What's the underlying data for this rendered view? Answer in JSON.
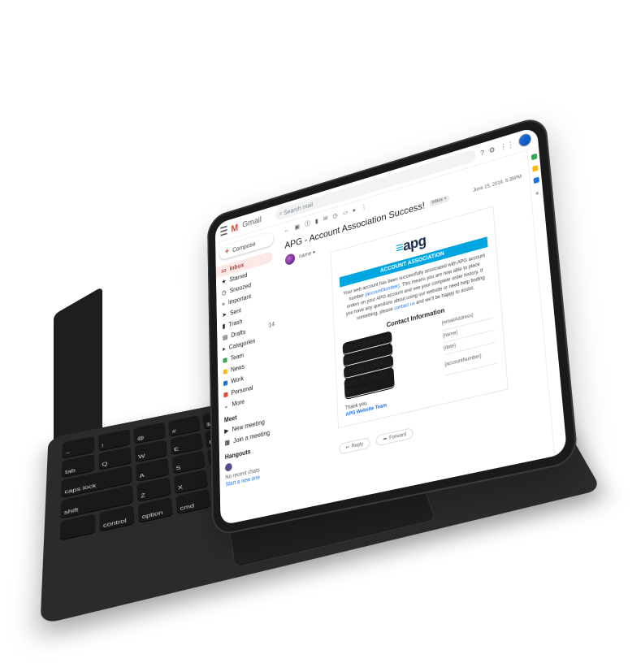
{
  "gmail": {
    "brand_text": "Gmail",
    "search_placeholder": "Search mail",
    "compose_label": "Compose",
    "nav": [
      {
        "label": "Inbox",
        "active": true
      },
      {
        "label": "Starred"
      },
      {
        "label": "Snoozed"
      },
      {
        "label": "Important"
      },
      {
        "label": "Sent"
      },
      {
        "label": "Trash"
      },
      {
        "label": "Drafts",
        "count": "14"
      },
      {
        "label": "Categories"
      },
      {
        "label": "Team"
      },
      {
        "label": "News"
      },
      {
        "label": "Work"
      },
      {
        "label": "Personal"
      },
      {
        "label": "More"
      }
    ],
    "meet": {
      "title": "Meet",
      "new_meeting": "New meeting",
      "join_meeting": "Join a meeting"
    },
    "hangouts": {
      "title": "Hangouts",
      "no_chats": "No recent chats",
      "start_new": "Start a new one"
    },
    "email": {
      "subject": "APG - Account Association Success!",
      "label": "Inbox ×",
      "date": "June 15, 2019, 5:35PM",
      "sender": "name ▾",
      "logo_prefix": "≡",
      "logo_text": "apg",
      "banner": "ACCOUNT ASSOCIATION",
      "body_part1": "Your web account has been successfully associated with APG account number ",
      "body_account": "{accountNumber}",
      "body_part2": ". This means you are now able to place orders on your APG account and see your complete order history. If you have any questions about using our website or need help finding something, please ",
      "body_contact": "contact us",
      "body_part3": " and we'll be happy to assist.",
      "contact_title": "Contact Information",
      "contact_rows": [
        {
          "key": "Email Address",
          "value": "{emailAddress}"
        },
        {
          "key": "Name",
          "value": "{name}"
        },
        {
          "key": "Created Date",
          "value": "{date}"
        },
        {
          "key": "APG Account Number",
          "value": "{accountNumber}"
        }
      ],
      "thanks": "Thank you,",
      "team": "APG Website Team"
    },
    "reply_label": "Reply",
    "forward_label": "Forward"
  },
  "keyboard": {
    "row1": [
      "~",
      "!",
      "@",
      "#",
      "$",
      "%",
      "^",
      "&",
      "*",
      "(",
      ")",
      "—",
      "+",
      "delete"
    ],
    "row2": [
      "tab",
      "Q",
      "W",
      "E",
      "R",
      "T",
      "Y",
      "U",
      "I",
      "O",
      "P",
      "{",
      "}",
      "|"
    ],
    "row3": [
      "caps lock",
      "A",
      "S",
      "D",
      "F",
      "G",
      "H",
      "J",
      "K",
      "L",
      ":",
      "\"",
      "return"
    ],
    "row4": [
      "shift",
      "Z",
      "X",
      "C",
      "V",
      "B",
      "N",
      "M",
      "<",
      ">",
      "?",
      "shift"
    ],
    "row5": [
      "",
      "control",
      "option",
      "cmd",
      "",
      "cmd",
      "option",
      "◀",
      "▲▼",
      "▶"
    ]
  },
  "colors": {
    "apg_blue": "#00a6e0",
    "apg_navy": "#1b2b4c",
    "gmail_red": "#ea4335",
    "device_dark": "#1a1a1c"
  }
}
